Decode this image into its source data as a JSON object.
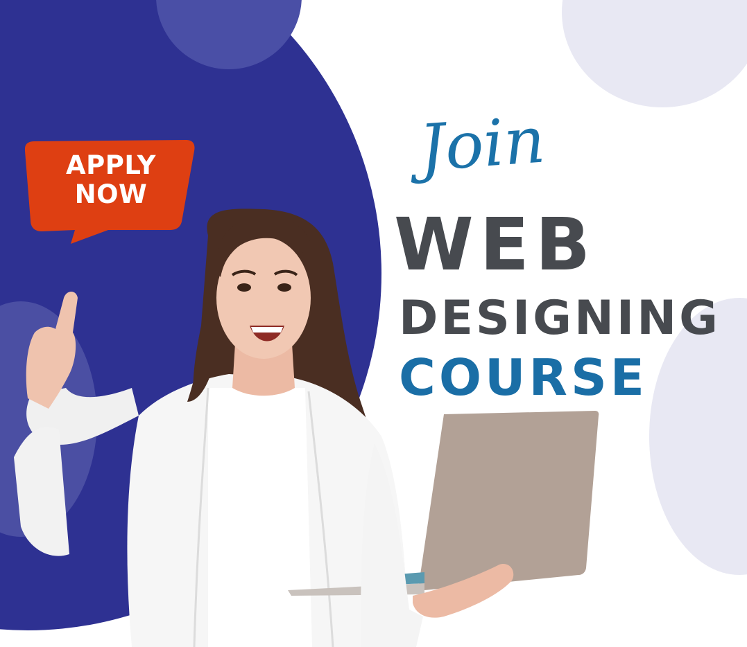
{
  "badge": {
    "line1": "APPLY",
    "line2": "NOW"
  },
  "headline": {
    "join": "Join",
    "web": "WEB",
    "designing": "DESIGNING",
    "course": "COURSE"
  },
  "colors": {
    "primary_blue": "#2e3192",
    "accent_blue": "#1b72a9",
    "badge_orange": "#de3f12",
    "text_gray": "#474a4f",
    "light_circle": "#e8e8f3"
  },
  "illustration": {
    "subject": "smiling-woman-with-laptop-icon"
  }
}
